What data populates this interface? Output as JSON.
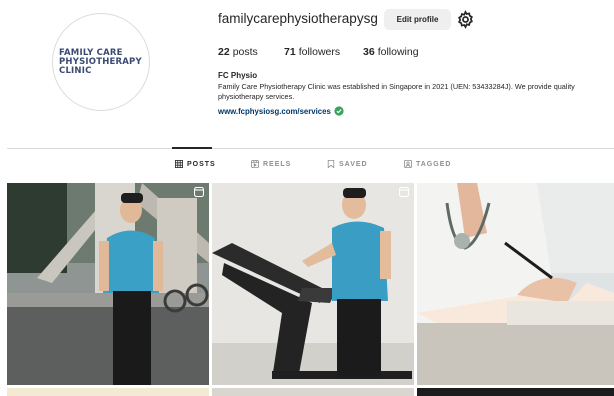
{
  "profile": {
    "logo_lines": [
      "FAMILY CARE",
      "PHYSIOTHERAPY",
      "CLINIC"
    ],
    "username": "familycarephysiotherapysg",
    "edit_button": "Edit profile",
    "settings_icon": "gear-icon",
    "stats": {
      "posts_count": "22",
      "posts_label": "posts",
      "followers_count": "71",
      "followers_label": "followers",
      "following_count": "36",
      "following_label": "following"
    },
    "bio": {
      "name": "FC Physio",
      "text": "Family Care Physiotherapy Clinic was established in Singapore in 2021 (UEN: 53433284J). We provide quality physiotherapy services.",
      "link": "www.fcphysiosg.com/services",
      "link_icon": "verified-check-icon"
    }
  },
  "tabs": [
    {
      "label": "POSTS",
      "icon": "grid-icon",
      "active": true
    },
    {
      "label": "REELS",
      "icon": "reels-icon",
      "active": false
    },
    {
      "label": "SAVED",
      "icon": "bookmark-icon",
      "active": false
    },
    {
      "label": "TAGGED",
      "icon": "tag-icon",
      "active": false
    }
  ],
  "posts": [
    {
      "subject": "man in blue shirt standing outdoors",
      "badge": "reel-icon"
    },
    {
      "subject": "man on treadmill",
      "badge": "reel-icon"
    },
    {
      "subject": "doctor with stethoscope writing notes"
    },
    {
      "subject": "partial post"
    },
    {
      "subject": "partial post"
    },
    {
      "subject": "partial post"
    }
  ],
  "colors": {
    "link": "#00376b",
    "verified": "#3aa35b",
    "button_bg": "#efefef",
    "muted": "#8e8e8e"
  }
}
